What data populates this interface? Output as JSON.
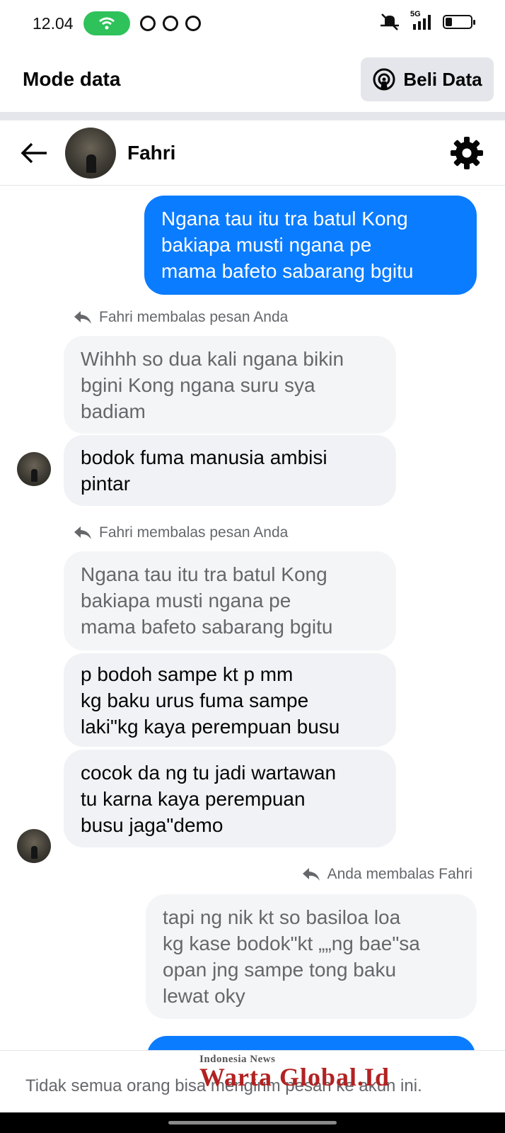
{
  "status_bar": {
    "time": "12.04",
    "network": "5G",
    "battery_level": 0.25
  },
  "mode_header": {
    "title": "Mode data",
    "buy_button": "Beli Data"
  },
  "chat_header": {
    "contact_name": "Fahri"
  },
  "messages": [
    {
      "type": "outgoing",
      "lines": [
        "Ngana tau itu tra batul Kong",
        "bakiapa musti ngana pe",
        "mama bafeto sabarang bgitu"
      ]
    },
    {
      "type": "reply_label",
      "text": "Fahri membalas pesan Anda"
    },
    {
      "type": "quoted",
      "lines": [
        "Wihhh so dua kali ngana bikin",
        "bgini Kong ngana suru sya",
        "badiam"
      ]
    },
    {
      "type": "incoming",
      "lines": [
        "bodok fuma manusia ambisi",
        "pintar"
      ]
    },
    {
      "type": "reply_label",
      "text": "Fahri membalas pesan Anda"
    },
    {
      "type": "quoted",
      "lines": [
        "Ngana tau itu tra batul Kong",
        "bakiapa musti ngana pe",
        "mama bafeto sabarang bgitu"
      ]
    },
    {
      "type": "incoming",
      "lines": [
        "p bodoh sampe kt p mm",
        "kg baku urus fuma sampe",
        "laki\"kg kaya perempuan busu"
      ]
    },
    {
      "type": "incoming",
      "lines": [
        "cocok da ng tu jadi wartawan",
        "tu karna kaya perempuan",
        "busu jaga\"demo"
      ]
    },
    {
      "type": "reply_label",
      "text": "Anda membalas Fahri"
    },
    {
      "type": "quoted",
      "lines": [
        "tapi ng nik kt so basiloa loa",
        "kg kase bodok\"kt „„ng bae\"sa",
        "opan jng sampe tong baku",
        "lewat oky"
      ]
    }
  ],
  "footer": {
    "notice": "Tidak semua orang bisa mengirim pesan ke akun ini."
  },
  "watermark": {
    "tagline": "Indonesia News",
    "brand": "Warta Global.Id"
  },
  "colors": {
    "outgoing_bubble": "#0a7cff",
    "incoming_bubble": "#f0f2f5",
    "secondary_text": "#65676b",
    "wifi_pill": "#2fc25b"
  },
  "icons": {
    "back": "arrow-left-icon",
    "settings": "gear-icon",
    "buy": "broadcast-icon",
    "reply": "reply-arrow-icon"
  }
}
